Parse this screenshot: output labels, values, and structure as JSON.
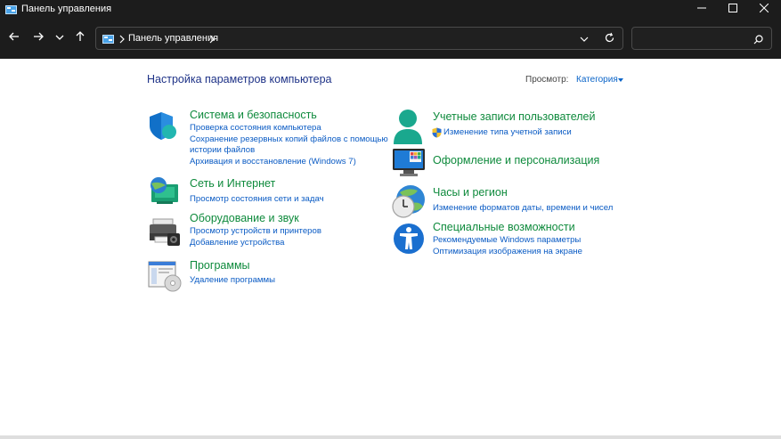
{
  "window": {
    "title": "Панель управления",
    "icons": {
      "app": "control-panel-icon",
      "minimize": "minimize-icon",
      "maximize": "maximize-icon",
      "close": "close-icon"
    }
  },
  "nav": {
    "icons": [
      "back-arrow-icon",
      "forward-arrow-icon",
      "recent-dropdown-icon",
      "up-arrow-icon"
    ],
    "address": {
      "path": "Панель управления",
      "icons": [
        "control-panel-icon",
        "chevron-right-icon",
        "dropdown-icon",
        "refresh-icon"
      ]
    },
    "search": {
      "value": "",
      "icon": "search-icon"
    }
  },
  "content": {
    "heading": "Настройка параметров компьютера",
    "view": {
      "label": "Просмотр:",
      "value": "Категория"
    },
    "left": [
      {
        "title": "Система и безопасность",
        "icon": "shield-icon",
        "links": [
          "Проверка состояния компьютера",
          "Сохранение резервных копий файлов с помощью",
          "истории файлов",
          "Архивация и восстановление (Windows 7)"
        ]
      },
      {
        "title": "Сеть и Интернет",
        "icon": "network-globe-icon",
        "links": [
          "Просмотр состояния сети и задач"
        ]
      },
      {
        "title": "Оборудование и звук",
        "icon": "printer-icon",
        "links": [
          "Просмотр устройств и принтеров",
          "Добавление устройства"
        ]
      },
      {
        "title": "Программы",
        "icon": "programs-icon",
        "links": [
          "Удаление программы"
        ]
      }
    ],
    "right": [
      {
        "title": "Учетные записи пользователей",
        "icon": "user-icon",
        "links": [
          "Изменение типа учетной записи"
        ],
        "link_icon": "uac-shield-icon"
      },
      {
        "title": "Оформление и персонализация",
        "icon": "monitor-icon",
        "links": []
      },
      {
        "title": "Часы и регион",
        "icon": "clock-globe-icon",
        "links": [
          "Изменение форматов даты, времени и чисел"
        ]
      },
      {
        "title": "Специальные возможности",
        "icon": "accessibility-icon",
        "links": [
          "Рекомендуемые Windows параметры",
          "Оптимизация изображения на экране"
        ]
      }
    ]
  },
  "colors": {
    "titlebar": "#1c1c1c",
    "heading": "#1e3287",
    "category_title": "#0e8a3c",
    "link": "#0a5bc4"
  }
}
